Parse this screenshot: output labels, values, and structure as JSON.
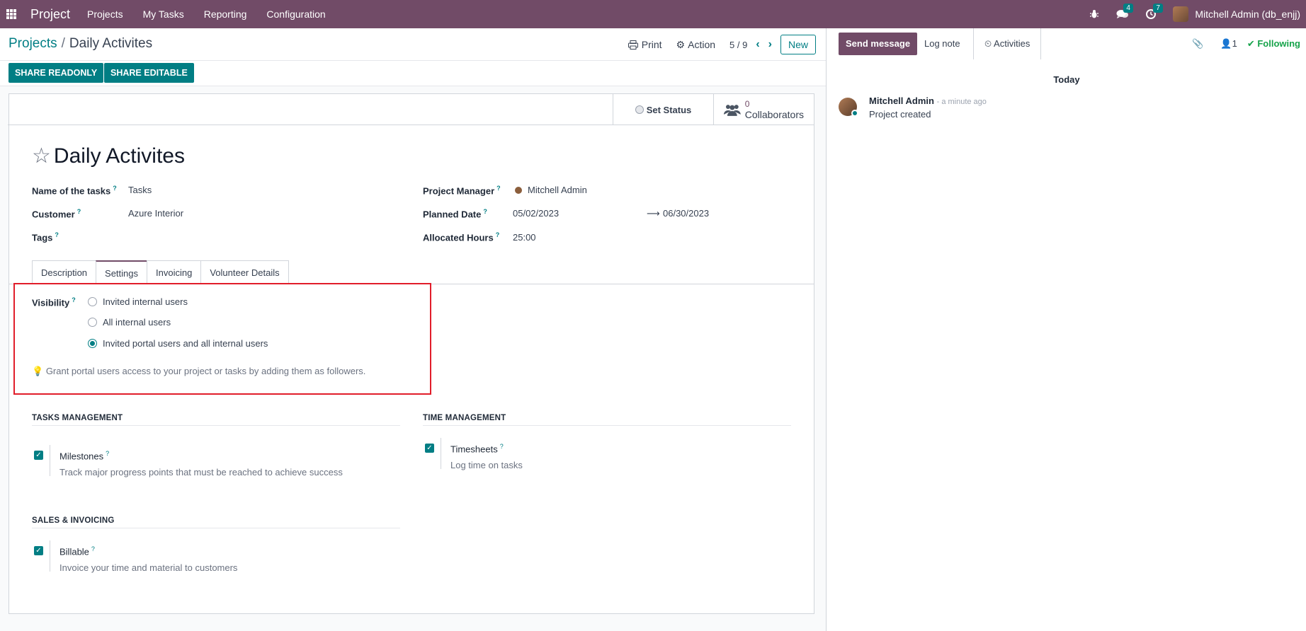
{
  "navbar": {
    "brand": "Project",
    "menu": [
      "Projects",
      "My Tasks",
      "Reporting",
      "Configuration"
    ],
    "messages_count": "4",
    "activities_count": "7",
    "user_name": "Mitchell Admin (db_enjj)",
    "color": "#714B67"
  },
  "breadcrumb": {
    "parent": "Projects",
    "sep": "/",
    "current": "Daily Activites"
  },
  "control": {
    "print": "Print",
    "action": "Action",
    "pager": "5 / 9",
    "new": "New"
  },
  "share": {
    "readonly": "SHARE READONLY",
    "editable": "SHARE EDITABLE"
  },
  "button_box": {
    "set_status": "Set Status",
    "collab_count": "0",
    "collab_label": "Collaborators"
  },
  "form": {
    "title": "Daily Activites",
    "name_of_tasks_label": "Name of the tasks",
    "name_of_tasks_value": "Tasks",
    "customer_label": "Customer",
    "customer_value": "Azure Interior",
    "tags_label": "Tags",
    "manager_label": "Project Manager",
    "manager_value": "Mitchell Admin",
    "planned_label": "Planned Date",
    "planned_start": "05/02/2023",
    "planned_end": "06/30/2023",
    "hours_label": "Allocated Hours",
    "hours_value": "25:00",
    "help": "?"
  },
  "tabs": [
    {
      "label": "Description"
    },
    {
      "label": "Settings"
    },
    {
      "label": "Invoicing"
    },
    {
      "label": "Volunteer Details"
    }
  ],
  "visibility": {
    "label": "Visibility",
    "options": [
      "Invited internal users",
      "All internal users",
      "Invited portal users and all internal users"
    ],
    "selected": 2,
    "hint": "Grant portal users access to your project or tasks by adding them as followers."
  },
  "tasks_mgmt": {
    "title": "TASKS MANAGEMENT",
    "milestones": "Milestones",
    "milestones_desc": "Track major progress points that must be reached to achieve success"
  },
  "time_mgmt": {
    "title": "TIME MANAGEMENT",
    "timesheets": "Timesheets",
    "timesheets_desc": "Log time on tasks"
  },
  "sales": {
    "title": "SALES & INVOICING",
    "billable": "Billable",
    "billable_desc": "Invoice your time and material to customers"
  },
  "chatter": {
    "send": "Send message",
    "log": "Log note",
    "activities": "Activities",
    "followers_count": "1",
    "following": "Following",
    "today": "Today",
    "author": "Mitchell Admin",
    "time": "- a minute ago",
    "body": "Project created"
  }
}
